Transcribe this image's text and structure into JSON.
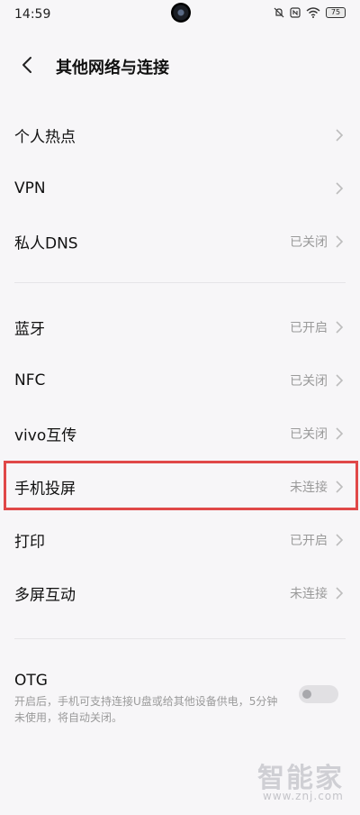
{
  "status_bar": {
    "time": "14:59",
    "battery": "75",
    "icons": [
      "mute-icon",
      "nfc-icon",
      "wifi-icon",
      "battery-icon"
    ]
  },
  "header": {
    "title": "其他网络与连接",
    "back_icon": "chevron-left-icon"
  },
  "groups": [
    {
      "items": [
        {
          "label": "个人热点",
          "value": ""
        },
        {
          "label": "VPN",
          "value": ""
        },
        {
          "label": "私人DNS",
          "value": "已关闭"
        }
      ]
    },
    {
      "items": [
        {
          "label": "蓝牙",
          "value": "已开启"
        },
        {
          "label": "NFC",
          "value": "已关闭"
        },
        {
          "label": "vivo互传",
          "value": "已关闭"
        },
        {
          "label": "手机投屏",
          "value": "未连接"
        },
        {
          "label": "打印",
          "value": "已开启"
        },
        {
          "label": "多屏互动",
          "value": "未连接"
        }
      ]
    }
  ],
  "otg": {
    "label": "OTG",
    "description": "开启后，手机可支持连接U盘或给其他设备供电，5分钟未使用，将自动关闭。",
    "enabled": false
  },
  "watermark": {
    "title": "智能家",
    "url": "www.znj.com"
  },
  "colors": {
    "background": "#f7f6f8",
    "highlight": "#e04848",
    "secondary_text": "#9a9a9a"
  }
}
